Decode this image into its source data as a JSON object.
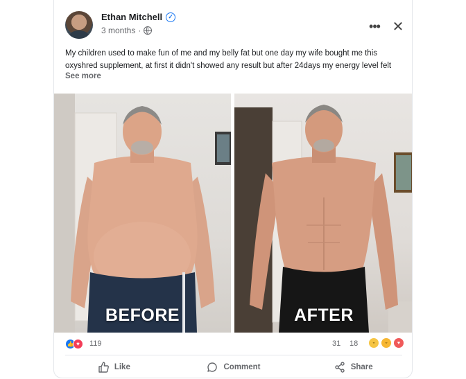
{
  "post": {
    "author": "Ethan Mitchell",
    "time": "3 months",
    "text": "My children used to make fun of me and my belly fat but one day my wife bought me this oxyshred supplement, at first it didn't showed any result but after 24days my energy level felt",
    "see_more": "See more",
    "verified_icon": "verified-badge-icon",
    "privacy_icon": "globe-icon"
  },
  "images": {
    "before_label": "BEFORE",
    "after_label": "AFTER"
  },
  "stats": {
    "reactions": "119",
    "comments": "31",
    "shares": "18"
  },
  "actions": {
    "like": "Like",
    "comment": "Comment",
    "share": "Share"
  },
  "colors": {
    "accent": "#1877f2",
    "love": "#f33e58",
    "muted_text": "#65676b"
  }
}
